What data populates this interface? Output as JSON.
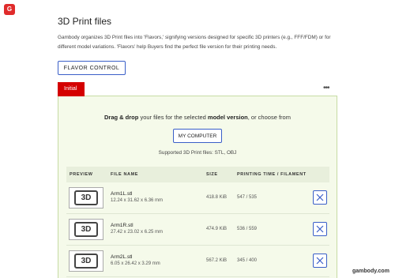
{
  "logo": {
    "text": "G"
  },
  "page": {
    "title": "3D Print files",
    "description": "Gambody organizes 3D Print files into 'Flavors,' signifying versions designed for specific 3D printers (e.g., FFF/FDM) or for different model variations. 'Flavors' help Buyers find the perfect file version for their printing needs."
  },
  "buttons": {
    "flavor_control": "FLAVOR CONTROL",
    "my_computer": "MY COMPUTER"
  },
  "tab": {
    "initial": "Initial"
  },
  "upload": {
    "drag_bold": "Drag & drop",
    "text_part1": " your files for the selected ",
    "model_version_bold": "model version",
    "text_part2": ", or choose from",
    "supported": "Supported 3D Print files: STL, OBJ"
  },
  "table": {
    "headers": {
      "preview": "PREVIEW",
      "file_name": "FILE NAME",
      "size": "SIZE",
      "printing": "PRINTING TIME / FILAMENT"
    },
    "rows": [
      {
        "thumb": "3D",
        "name": "Arm1L.stl",
        "dims": "12.24 x 31.62 x 6.36 mm",
        "size": "418.8 KiB",
        "time": "547 / 535"
      },
      {
        "thumb": "3D",
        "name": "Arm1R.stl",
        "dims": "27.42 x 23.02 x 6.25 mm",
        "size": "474.9 KiB",
        "time": "536 / 559"
      },
      {
        "thumb": "3D",
        "name": "Arm2L.stl",
        "dims": "6.05 x 26.42 x 3.29 mm",
        "size": "567.2 KiB",
        "time": "345 / 400"
      }
    ]
  },
  "watermark": "gambody.com",
  "colors": {
    "accent": "#3a5fc8",
    "tab": "#d40000",
    "panel_bg": "#f5faea",
    "panel_border": "#c6dca4",
    "logo": "#e02b2b"
  },
  "icons": [
    "logo-icon",
    "more-icon",
    "remove-icon"
  ]
}
